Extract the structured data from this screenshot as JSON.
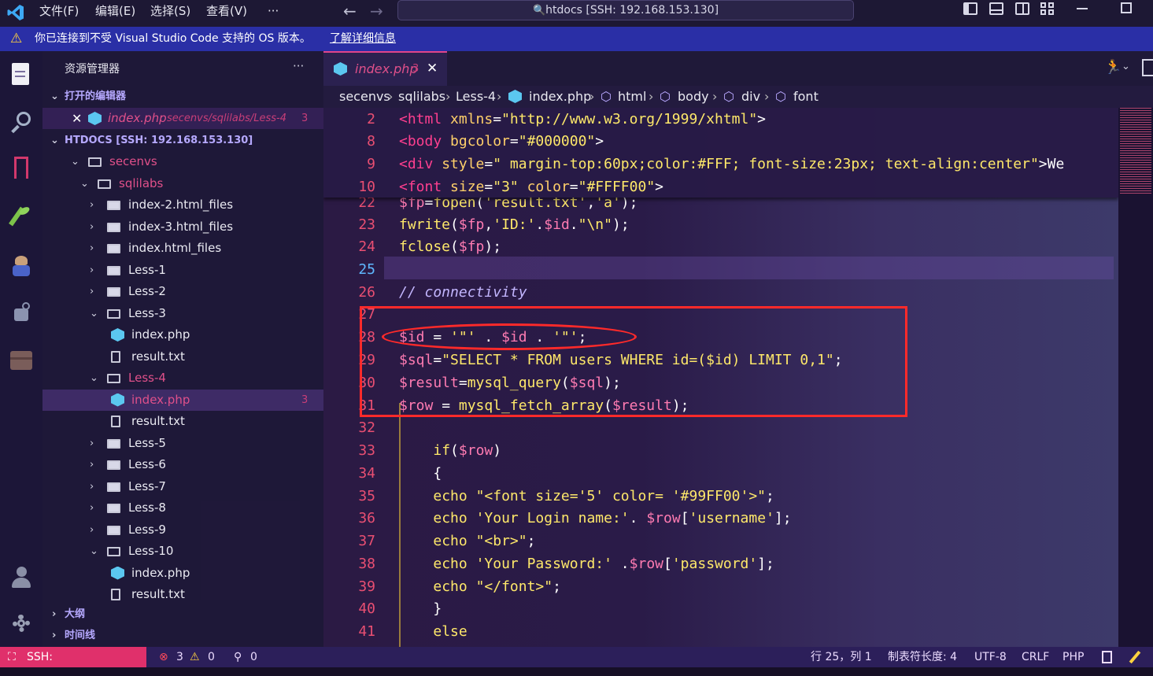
{
  "titlebar": {
    "menus": [
      "文件(F)",
      "编辑(E)",
      "选择(S)",
      "查看(V)",
      "···"
    ],
    "command_center": "htdocs [SSH: 192.168.153.130]"
  },
  "warning": {
    "message": "你已连接到不受 Visual Studio Code 支持的 OS 版本。",
    "link": "了解详细信息"
  },
  "sidebar": {
    "title": "资源管理器",
    "more": "···",
    "open_editors_label": "打开的编辑器",
    "open_editor": {
      "name": "index.php",
      "path": "secenvs/sqlilabs/Less-4",
      "problems": "3"
    },
    "root_label": "HTDOCS [SSH: 192.168.153.130]",
    "tree": [
      {
        "label": "secenvs",
        "kind": "folder-open",
        "depth": 1,
        "color": "#e0508a"
      },
      {
        "label": "sqlilabs",
        "kind": "folder-open",
        "depth": 2,
        "color": "#e0508a"
      },
      {
        "label": "index-2.html_files",
        "kind": "folder",
        "depth": 3
      },
      {
        "label": "index-3.html_files",
        "kind": "folder",
        "depth": 3
      },
      {
        "label": "index.html_files",
        "kind": "folder",
        "depth": 3
      },
      {
        "label": "Less-1",
        "kind": "folder",
        "depth": 3
      },
      {
        "label": "Less-2",
        "kind": "folder",
        "depth": 3
      },
      {
        "label": "Less-3",
        "kind": "folder-open",
        "depth": 3
      },
      {
        "label": "index.php",
        "kind": "php",
        "depth": 4
      },
      {
        "label": "result.txt",
        "kind": "txt",
        "depth": 4
      },
      {
        "label": "Less-4",
        "kind": "folder-open",
        "depth": 3,
        "color": "#e0508a"
      },
      {
        "label": "index.php",
        "kind": "php",
        "depth": 4,
        "color": "#e0508a",
        "selected": true,
        "badge": "3"
      },
      {
        "label": "result.txt",
        "kind": "txt",
        "depth": 4
      },
      {
        "label": "Less-5",
        "kind": "folder",
        "depth": 3
      },
      {
        "label": "Less-6",
        "kind": "folder",
        "depth": 3
      },
      {
        "label": "Less-7",
        "kind": "folder",
        "depth": 3
      },
      {
        "label": "Less-8",
        "kind": "folder",
        "depth": 3
      },
      {
        "label": "Less-9",
        "kind": "folder",
        "depth": 3
      },
      {
        "label": "Less-10",
        "kind": "folder-open",
        "depth": 3
      },
      {
        "label": "index.php",
        "kind": "php",
        "depth": 4
      },
      {
        "label": "result.txt",
        "kind": "txt",
        "depth": 4
      }
    ],
    "outline_label": "大纲",
    "timeline_label": "时间线"
  },
  "editor": {
    "tab": {
      "name": "index.php",
      "badge": "3"
    },
    "breadcrumb": [
      "secenvs",
      "sqlilabs",
      "Less-4",
      "index.php",
      "html",
      "body",
      "div",
      "font"
    ],
    "sticky_lines": [
      {
        "n": "2",
        "code": "<html xmlns=\"http://www.w3.org/1999/xhtml\">"
      },
      {
        "n": "8",
        "code": "<body bgcolor=\"#000000\">"
      },
      {
        "n": "9",
        "code": "<div style=\" margin-top:60px;color:#FFF; font-size:23px; text-align:center\">We"
      },
      {
        "n": "10",
        "code": "<font size=\"3\" color=\"#FFFF00\">"
      }
    ],
    "lines": [
      {
        "n": "22",
        "code": "$fp=fopen('result.txt','a');"
      },
      {
        "n": "23",
        "code": "fwrite($fp,'ID:'.$id.\"\\n\");"
      },
      {
        "n": "24",
        "code": "fclose($fp);"
      },
      {
        "n": "25",
        "code": ""
      },
      {
        "n": "26",
        "code": "// connectivity"
      },
      {
        "n": "27",
        "code": ""
      },
      {
        "n": "28",
        "code": "$id = '\"' . $id . '\"';"
      },
      {
        "n": "29",
        "code": "$sql=\"SELECT * FROM users WHERE id=($id) LIMIT 0,1\";"
      },
      {
        "n": "30",
        "code": "$result=mysql_query($sql);"
      },
      {
        "n": "31",
        "code": "$row = mysql_fetch_array($result);"
      },
      {
        "n": "32",
        "code": ""
      },
      {
        "n": "33",
        "code": "    if($row)"
      },
      {
        "n": "34",
        "code": "    {"
      },
      {
        "n": "35",
        "code": "    echo \"<font size='5' color= '#99FF00'>\";"
      },
      {
        "n": "36",
        "code": "    echo 'Your Login name:'. $row['username'];"
      },
      {
        "n": "37",
        "code": "    echo \"<br>\";"
      },
      {
        "n": "38",
        "code": "    echo 'Your Password:' .$row['password'];"
      },
      {
        "n": "39",
        "code": "    echo \"</font>\";"
      },
      {
        "n": "40",
        "code": "    }"
      },
      {
        "n": "41",
        "code": "    else"
      }
    ]
  },
  "statusbar": {
    "remote": "SSH: 192.168.153.130",
    "errors": "3",
    "warnings": "0",
    "ports": "0",
    "position": "行 25，列 1",
    "tab_size": "制表符长度: 4",
    "encoding": "UTF-8",
    "eol": "CRLF",
    "language": "PHP"
  },
  "colors": {
    "accent": "#e0306b",
    "warning_bar": "#2a2fa6",
    "annotation": "#ff2a2a"
  }
}
